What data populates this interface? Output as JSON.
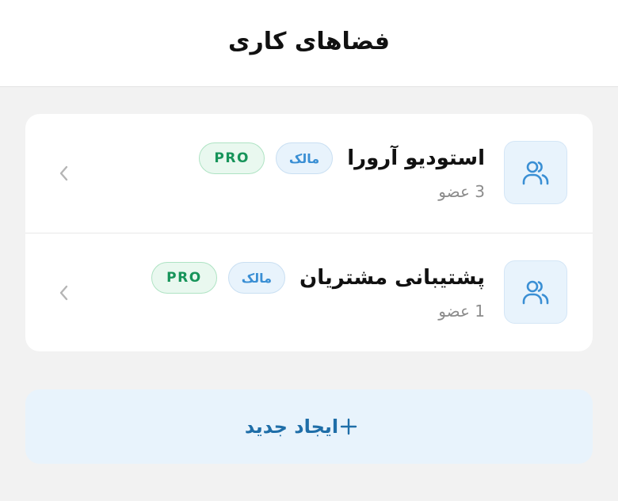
{
  "header": {
    "title": "فضاهای کاری"
  },
  "workspaces": [
    {
      "name": "استودیو آرورا",
      "role": "مالک",
      "plan": "PRO",
      "members": "3 عضو",
      "icon": "users-icon"
    },
    {
      "name": "پشتیبانی مشتریان",
      "role": "مالک",
      "plan": "PRO",
      "members": "1 عضو",
      "icon": "users-icon"
    }
  ],
  "create_button": {
    "label": "ایجاد جدید",
    "icon": "plus-icon"
  },
  "colors": {
    "accent": "#3a8fd4",
    "accent_bg": "#e8f3fc",
    "pro_green": "#17945a",
    "background": "#f2f2f2"
  }
}
